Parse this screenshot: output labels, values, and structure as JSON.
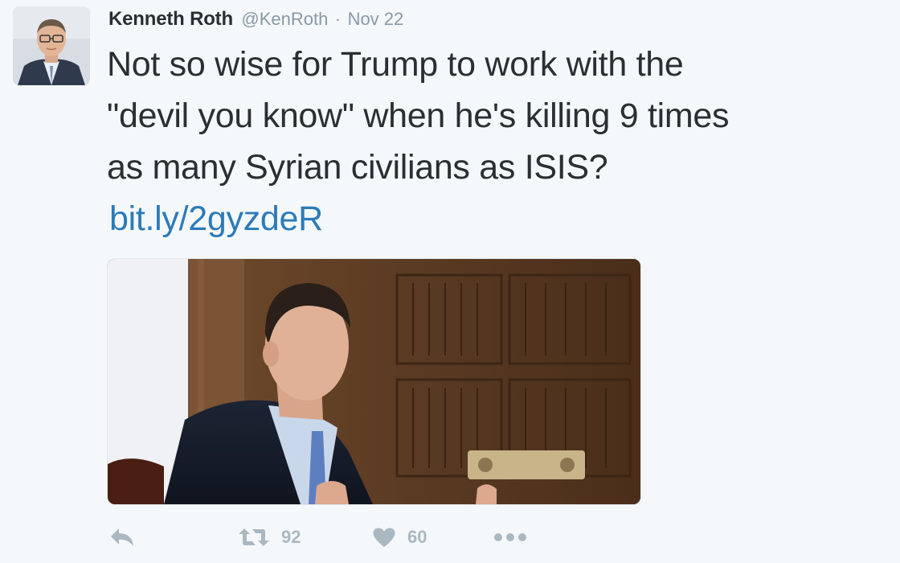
{
  "tweet": {
    "author_name": "Kenneth Roth",
    "author_handle": "@KenRoth",
    "separator": "·",
    "timestamp": "Nov 22",
    "text_lines": [
      "Not so wise for Trump to work with the",
      "\"devil you know\" when he's killing 9 times",
      "as many Syrian civilians as ISIS?"
    ],
    "link": "bit.ly/2gyzdeR"
  },
  "actions": {
    "reply_icon": "reply-icon",
    "retweet_icon": "retweet-icon",
    "retweet_count": "92",
    "like_icon": "heart-icon",
    "like_count": "60",
    "more_icon": "more-dots-icon"
  },
  "colors": {
    "background": "#f5f8fa",
    "text": "#292f33",
    "muted": "#8899a6",
    "link": "#2b7bb9",
    "action": "#aab8c2"
  }
}
